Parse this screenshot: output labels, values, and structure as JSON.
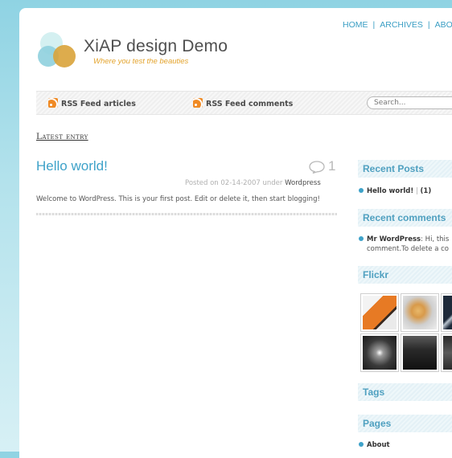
{
  "nav": {
    "items": [
      "HOME",
      "ARCHIVES",
      "ABOUT"
    ],
    "separator": "|"
  },
  "site": {
    "title": "XiAP design Demo",
    "tagline": "Where you test the beauties"
  },
  "feeds": {
    "articles": "RSS Feed articles",
    "comments": "RSS Feed comments"
  },
  "search": {
    "placeholder": "Search..."
  },
  "main": {
    "section_label": "Latest entry",
    "post": {
      "title": "Hello world!",
      "comment_count": "1",
      "posted_prefix": "Posted on 02-14-2007 under",
      "category": "Wordpress",
      "body": "Welcome to WordPress. This is your first post. Edit or delete it, then start blogging!"
    }
  },
  "sidebar": {
    "recent_posts": {
      "title": "Recent Posts",
      "item_title": "Hello world!",
      "item_sep": "|",
      "item_count": "(1)"
    },
    "recent_comments": {
      "title": "Recent comments",
      "author": "Mr WordPress",
      "line1": ": Hi, this",
      "line2": "comment.To delete a co"
    },
    "flickr": {
      "title": "Flickr"
    },
    "tags": {
      "title": "Tags"
    },
    "pages": {
      "title": "Pages",
      "items": [
        "About"
      ]
    }
  },
  "colors": {
    "accent": "#3ea2c9",
    "tagline": "#e3a32c",
    "background": "#8fd3e3"
  }
}
